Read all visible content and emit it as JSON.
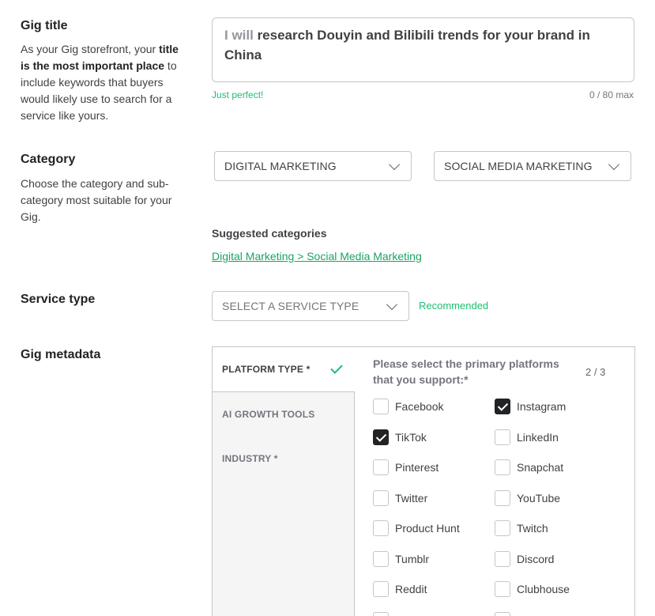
{
  "gig_title": {
    "heading": "Gig title",
    "desc_1": "As your Gig storefront, your ",
    "desc_bold": "title is the most important place",
    "desc_2": " to include keywords that buyers would likely use to search for a service like yours.",
    "prefix": "I will",
    "value": " research Douyin and Bilibili trends for your brand in China",
    "hint": "Just perfect!",
    "counter": "0 / 80 max"
  },
  "category": {
    "heading": "Category",
    "desc": "Choose the category and sub-category most suitable for your Gig.",
    "category_value": "DIGITAL MARKETING",
    "subcategory_value": "SOCIAL MEDIA MARKETING",
    "suggested_title": "Suggested categories",
    "suggested_link": "Digital Marketing > Social Media Marketing"
  },
  "service_type": {
    "heading": "Service type",
    "placeholder": "SELECT A SERVICE TYPE",
    "recommended": "Recommended"
  },
  "metadata": {
    "heading": "Gig metadata",
    "tabs": [
      {
        "label": "PLATFORM TYPE *",
        "active": true,
        "complete": true
      },
      {
        "label": "AI GROWTH TOOLS",
        "active": false
      },
      {
        "label": "INDUSTRY *",
        "active": false
      }
    ],
    "question": "Please select the primary platforms that you support:*",
    "count": "2 / 3",
    "options_left": [
      {
        "label": "Facebook",
        "checked": false
      },
      {
        "label": "TikTok",
        "checked": true
      },
      {
        "label": "Pinterest",
        "checked": false
      },
      {
        "label": "Twitter",
        "checked": false
      },
      {
        "label": "Product Hunt",
        "checked": false
      },
      {
        "label": "Tumblr",
        "checked": false
      },
      {
        "label": "Reddit",
        "checked": false
      }
    ],
    "options_right": [
      {
        "label": "Instagram",
        "checked": true
      },
      {
        "label": "LinkedIn",
        "checked": false
      },
      {
        "label": "Snapchat",
        "checked": false
      },
      {
        "label": "YouTube",
        "checked": false
      },
      {
        "label": "Twitch",
        "checked": false
      },
      {
        "label": "Discord",
        "checked": false
      },
      {
        "label": "Clubhouse",
        "checked": false
      }
    ]
  },
  "colors": {
    "accent": "#1dbf73",
    "checked_box": "#222325",
    "border": "#c5c6c9"
  }
}
